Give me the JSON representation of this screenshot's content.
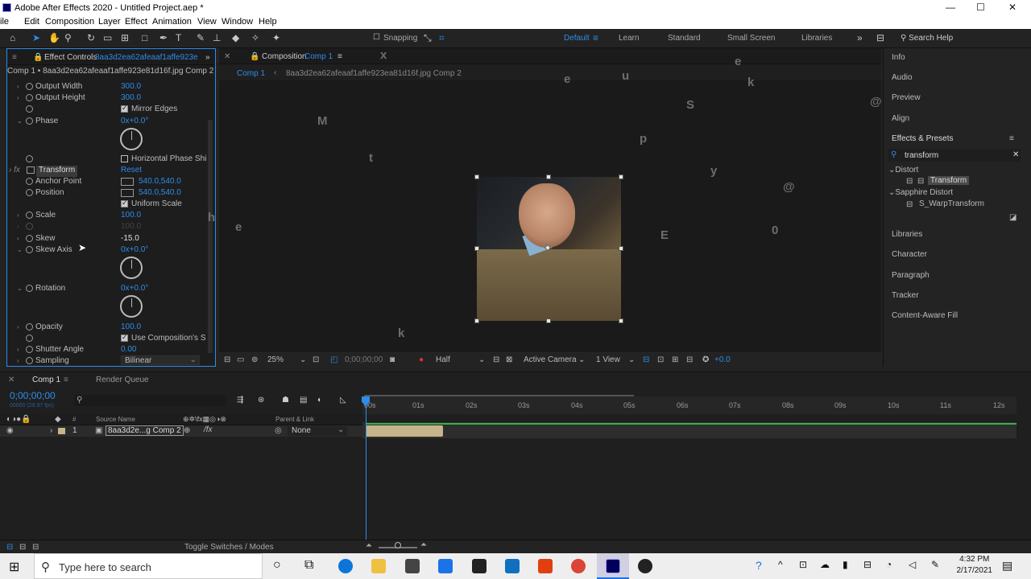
{
  "window": {
    "title": "Adobe After Effects 2020 - Untitled Project.aep *",
    "min": "—",
    "max": "☐",
    "close": "✕"
  },
  "menu": [
    "ile",
    "Edit",
    "Composition",
    "Layer",
    "Effect",
    "Animation",
    "View",
    "Window",
    "Help"
  ],
  "toolbar": {
    "snapping": "Snapping",
    "workspaces": [
      "Default",
      "Learn",
      "Standard",
      "Small Screen",
      "Libraries"
    ],
    "search_help": "Search Help"
  },
  "effect_controls": {
    "tab": "Effect Controls",
    "tab_file": "8aa3d2ea62afeaaf1affe923e",
    "header": "Comp 1 • 8aa3d2ea62afeaaf1affe923e81d16f.jpg Comp 2",
    "props": [
      {
        "label": "Output Width",
        "value": "300.0"
      },
      {
        "label": "Output Height",
        "value": "300.0"
      },
      {
        "label": "Mirror Edges"
      },
      {
        "label": "Phase",
        "value": "0x+0.0°"
      },
      {
        "label": "Horizontal Phase Shi"
      },
      {
        "label": "Transform",
        "value": "Reset"
      },
      {
        "label": "Anchor Point",
        "value": "540.0,540.0"
      },
      {
        "label": "Position",
        "value": "540.0,540.0"
      },
      {
        "label": "Uniform Scale"
      },
      {
        "label": "Scale",
        "value": "100.0"
      },
      {
        "label": "",
        "value": "100.0"
      },
      {
        "label": "Skew",
        "value": "-15.0"
      },
      {
        "label": "Skew Axis",
        "value": "0x+0.0°"
      },
      {
        "label": "Rotation",
        "value": "0x+0.0°"
      },
      {
        "label": "Opacity",
        "value": "100.0"
      },
      {
        "label": "Use Composition's S"
      },
      {
        "label": "Shutter Angle",
        "value": "0.00"
      },
      {
        "label": "Sampling",
        "value": "Bilinear"
      }
    ]
  },
  "composition": {
    "tab": "Composition",
    "tab_comp": "Comp 1",
    "crumb1": "Comp 1",
    "crumb2": "8aa3d2ea62afeaaf1affe923ea81d16f.jpg Comp 2",
    "letters": [
      "x",
      "e",
      "u",
      "k",
      "M",
      "S",
      "p",
      "t",
      "y",
      "@",
      "e",
      "E",
      "0",
      "@",
      "k",
      "e",
      "@",
      "h"
    ],
    "bar": {
      "zoom": "25%",
      "timecode": "0;00;00;00",
      "resolution": "Half",
      "camera": "Active Camera",
      "views": "1 View",
      "exposure": "+0.0"
    }
  },
  "right_panel": {
    "items": [
      "Info",
      "Audio",
      "Preview",
      "Align",
      "Effects & Presets",
      "Libraries",
      "Character",
      "Paragraph",
      "Tracker",
      "Content-Aware Fill"
    ],
    "search": "transform",
    "tree": [
      {
        "group": "Distort",
        "item": "Transform"
      },
      {
        "group": "Sapphire Distort",
        "item": "S_WarpTransform"
      }
    ]
  },
  "timeline": {
    "tab": "Comp 1",
    "render_queue": "Render Queue",
    "timecode": "0;00;00;00",
    "fps": "00000 (29.97 fps)",
    "source_name": "Source Name",
    "parent_link": "Parent & Link",
    "layer": {
      "num": "1",
      "name": "8aa3d2e...g Comp 2",
      "parent": "None"
    },
    "ticks": [
      "00s",
      "01s",
      "02s",
      "03s",
      "04s",
      "05s",
      "06s",
      "07s",
      "08s",
      "09s",
      "10s",
      "11s",
      "12s"
    ],
    "toggle": "Toggle Switches / Modes"
  },
  "taskbar": {
    "search": "Type here to search",
    "time": "4:32 PM",
    "date": "2/17/2021"
  }
}
